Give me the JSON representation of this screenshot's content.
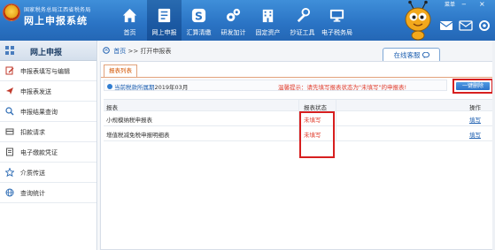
{
  "header": {
    "logo_subtitle": "国家税务总局江西省税务局",
    "logo_title": "网上申报系统",
    "menu_link": "菜单",
    "minimize": "−",
    "close": "×"
  },
  "nav": [
    {
      "label": "首页",
      "icon": "home-icon"
    },
    {
      "label": "网上申报",
      "icon": "document-icon",
      "active": true
    },
    {
      "label": "汇算清缴",
      "icon": "dollar-icon"
    },
    {
      "label": "研发加计",
      "icon": "gears-icon"
    },
    {
      "label": "固定资产",
      "icon": "building-icon"
    },
    {
      "label": "抄证工具",
      "icon": "tools-icon"
    },
    {
      "label": "电子税务局",
      "icon": "monitor-icon"
    }
  ],
  "sidebar": {
    "title": "网上申报",
    "items": [
      {
        "label": "申报表填写与编辑",
        "icon": "edit-icon"
      },
      {
        "label": "申报表发送",
        "icon": "send-icon"
      },
      {
        "label": "申报结果查询",
        "icon": "search-icon"
      },
      {
        "label": "扣款请求",
        "icon": "payment-icon"
      },
      {
        "label": "电子缴款凭证",
        "icon": "receipt-icon"
      },
      {
        "label": "介质传送",
        "icon": "star-icon"
      },
      {
        "label": "查询统计",
        "icon": "globe-icon"
      }
    ]
  },
  "main": {
    "breadcrumb_home": "首页",
    "breadcrumb_sep": ">>",
    "breadcrumb_current": "打开申报表",
    "service_button": "在线客服",
    "tab_label": "报表列表",
    "period_label": "当前税款所属期",
    "period_value": "2019年03月",
    "tip": "温馨提示：请先填写报表状态为\"未填写\"的申报表!",
    "onekey_button": "一键删除",
    "table": {
      "headers": {
        "name": "报表",
        "status": "报表状态",
        "op": "操作"
      },
      "rows": [
        {
          "name": "小规模纳税申报表",
          "status": "未填写",
          "op": "填写"
        },
        {
          "name": "增值税减免税申报明细表",
          "status": "未填写",
          "op": "填写"
        }
      ]
    }
  },
  "colors": {
    "header_blue": "#2a73c4",
    "accent_red": "#d71f1f",
    "link_blue": "#1d5fb0",
    "tab_orange": "#d35400"
  }
}
